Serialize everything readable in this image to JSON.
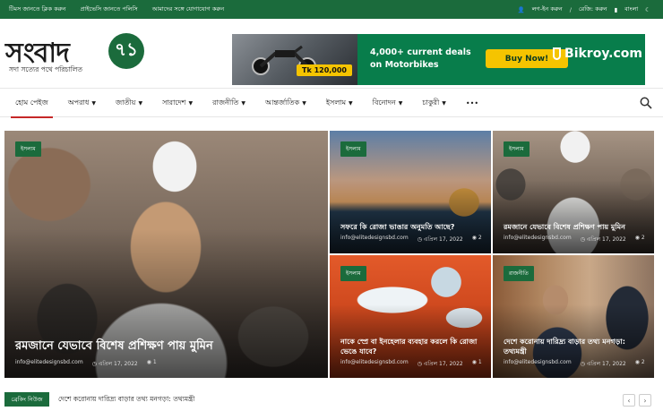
{
  "topbar": {
    "left_links": [
      "টিমস জানতে ক্লিক করুন",
      "প্রাইভেসি জানতে পলিসি",
      "আমাদের সঙ্গে যোগাযোগ করুন"
    ],
    "login": "লগ-ইন করুন",
    "register": "রেজি: করুন",
    "language": "বাংলা"
  },
  "logo": {
    "name": "সংবাদ",
    "badge": "৭১",
    "tagline": "সদা সত্যের পথে পরিচালিত"
  },
  "ad": {
    "price": "Tk 120,000",
    "deals_line1": "4,000+ current deals",
    "deals_line2": "on Motorbikes",
    "cta": "Buy Now!",
    "brand": "Bikroy.com"
  },
  "nav": {
    "items": [
      {
        "label": "হোম পেইজ",
        "caret": false
      },
      {
        "label": "অপরাধ",
        "caret": true
      },
      {
        "label": "জাতীয়",
        "caret": true
      },
      {
        "label": "সারাদেশ",
        "caret": true
      },
      {
        "label": "রাজনীতি",
        "caret": true
      },
      {
        "label": "আন্তর্জাতিক",
        "caret": true
      },
      {
        "label": "ইসলাম",
        "caret": true
      },
      {
        "label": "বিনোদন",
        "caret": true
      },
      {
        "label": "চাকুরী",
        "caret": true
      },
      {
        "label": "•••",
        "caret": false
      }
    ]
  },
  "posts": [
    {
      "category": "ইসলাম",
      "title": "রমজানে যেভাবে বিশেষ প্রশিক্ষণ পায় মুমিন",
      "author": "info@elitedesignsbd.com",
      "date": "এপ্রিল 17, 2022",
      "views": "1"
    },
    {
      "category": "ইসলাম",
      "title": "সফরে কি রোজা ভাঙার অনুমতি আছে?",
      "author": "info@elitedesignsbd.com",
      "date": "এপ্রিল 17, 2022",
      "views": "2"
    },
    {
      "category": "ইসলাম",
      "title": "রমজানে যেভাবে বিশেষ প্রশিক্ষণ পায় মুমিন",
      "author": "info@elitedesignsbd.com",
      "date": "এপ্রিল 17, 2022",
      "views": "2"
    },
    {
      "category": "ইসলাম",
      "title": "নাকে স্প্রে বা ইনহেলার ব্যবহার করলে কি রোজা ভেঙে যাবে?",
      "author": "info@elitedesignsbd.com",
      "date": "এপ্রিল 17, 2022",
      "views": "1"
    },
    {
      "category": "রাজনীতি",
      "title": "দেশে করোনায় দারিদ্র্য বাড়ার তথ্য মনগড়া: তথ্যমন্ত্রী",
      "author": "info@elitedesignsbd.com",
      "date": "এপ্রিল 17, 2022",
      "views": "2"
    }
  ],
  "breaking": {
    "label": "ব্রেকিং নিউজ",
    "text": "দেশে করোনায় দারিদ্র্য বাড়ার তথ্য মনগড়া: তথ্যমন্ত্রী",
    "prev": "‹",
    "next": "›"
  }
}
